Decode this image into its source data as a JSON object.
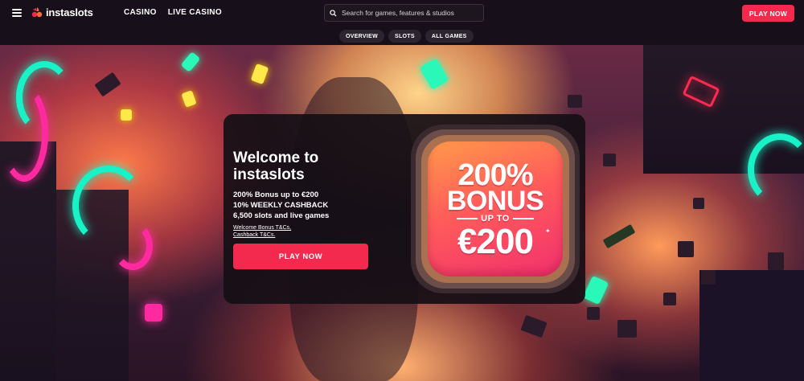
{
  "header": {
    "logo_text": "instaslots",
    "nav": [
      "CASINO",
      "LIVE CASINO"
    ],
    "search_placeholder": "Search for games, features & studios",
    "play_label": "PLAY NOW"
  },
  "subnav": {
    "tabs": [
      "OVERVIEW",
      "SLOTS",
      "ALL GAMES"
    ]
  },
  "hero": {
    "title": "Welcome to instaslots",
    "bullets": [
      "200% Bonus up to €200",
      "10% WEEKLY CASHBACK",
      "6,500 slots and live games"
    ],
    "links": [
      "Welcome Bonus T&Cs,",
      "Cashback T&Cs."
    ],
    "cta_label": "PLAY NOW",
    "bonus_tile": {
      "line1": "200%",
      "line2": "BONUS",
      "line3": "UP TO",
      "line4": "€200"
    }
  },
  "colors": {
    "accent": "#f32a4d",
    "header_bg": "#17101a",
    "pill_bg": "#2c2530",
    "card_bg": "#160f16"
  },
  "icons": [
    "menu-icon",
    "logo-icon",
    "search-icon",
    "sparkle-icon"
  ]
}
